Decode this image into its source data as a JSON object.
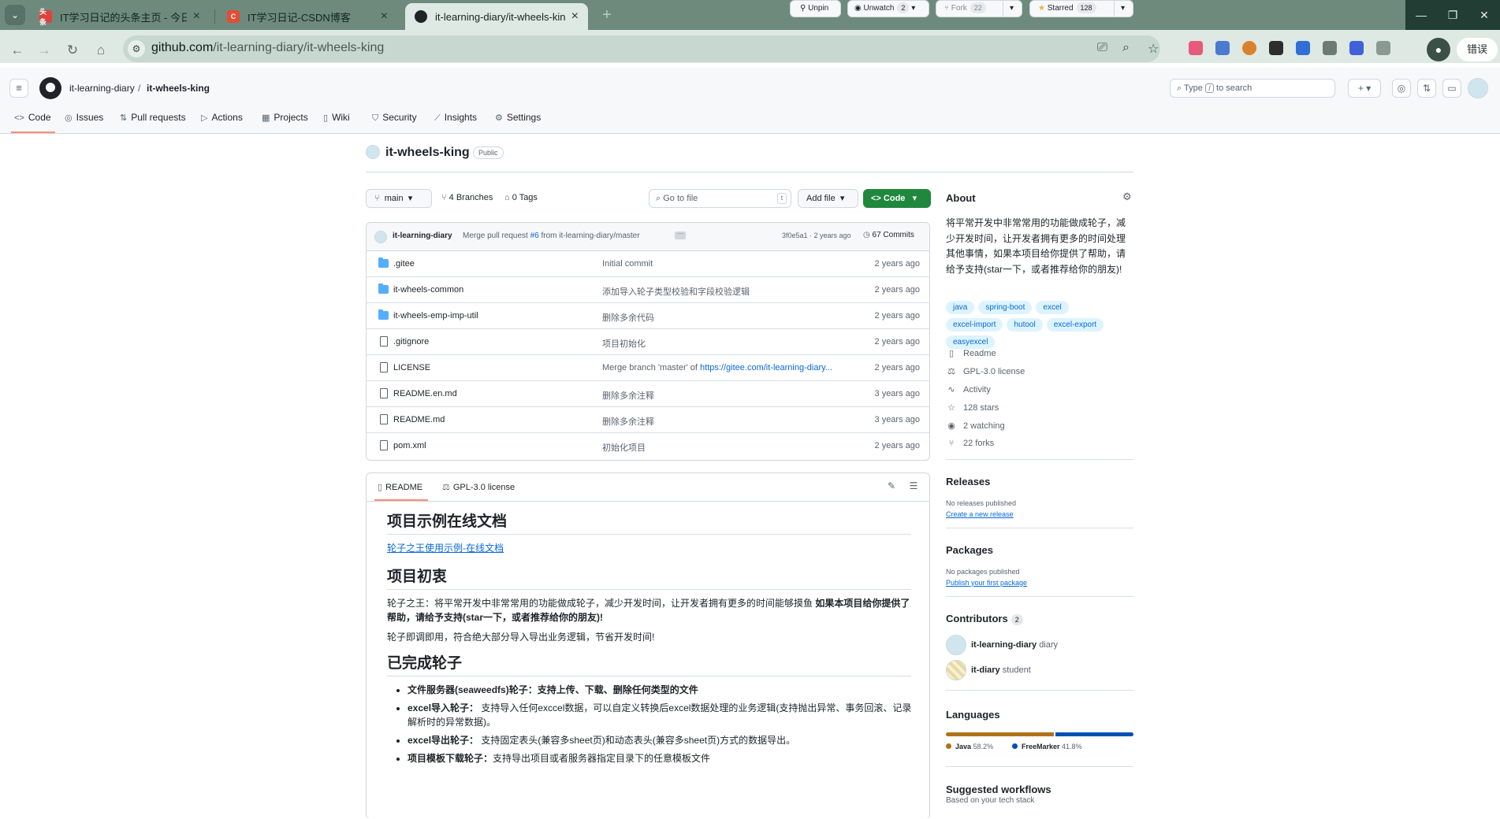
{
  "browser": {
    "tabs": [
      {
        "title": "IT学习日记的头条主页 - 今日头条",
        "favicon": "toutiao",
        "color": "#e0413b",
        "fav_text": "头条"
      },
      {
        "title": "IT学习日记-CSDN博客",
        "favicon": "csdn",
        "color": "#e24d33",
        "fav_text": "C"
      },
      {
        "title": "it-learning-diary/it-wheels-king",
        "favicon": "github",
        "color": "#1f2328",
        "fav_text": ""
      }
    ],
    "url_host": "github.com",
    "url_path": "/it-learning-diary/it-wheels-king",
    "profile_label": "错误",
    "window_controls": [
      "—",
      "❐",
      "✕"
    ]
  },
  "header": {
    "owner": "it-learning-diary",
    "separator": "/",
    "repo": "it-wheels-king",
    "search_prefix": "Type",
    "search_key": "/",
    "search_suffix": "to search",
    "plus_label": "+ ▾"
  },
  "repo_nav": [
    {
      "label": "Code",
      "icon": "<>"
    },
    {
      "label": "Issues",
      "icon": "◎"
    },
    {
      "label": "Pull requests",
      "icon": "⇅"
    },
    {
      "label": "Actions",
      "icon": "▷"
    },
    {
      "label": "Projects",
      "icon": "▦"
    },
    {
      "label": "Wiki",
      "icon": "▯"
    },
    {
      "label": "Security",
      "icon": "⛉"
    },
    {
      "label": "Insights",
      "icon": "⟋"
    },
    {
      "label": "Settings",
      "icon": "⚙"
    }
  ],
  "repo": {
    "name": "it-wheels-king",
    "visibility": "Public",
    "unpin": "Unpin",
    "unwatch": "Unwatch",
    "watch_count": "2",
    "fork": "Fork",
    "fork_count": "22",
    "starred": "Starred",
    "star_count": "128"
  },
  "controls": {
    "branch": "main",
    "branches": "4 Branches",
    "tags": "0 Tags",
    "goto_file": "Go to file",
    "goto_key": "t",
    "add_file": "Add file",
    "code": "Code"
  },
  "latest_commit": {
    "author": "it-learning-diary",
    "message_prefix": "Merge pull request",
    "pr": "#6",
    "message_suffix": "from it-learning-diary/master",
    "dots": "···",
    "sha_time": "3f0e5a1 · 2 years ago",
    "commits": "67 Commits"
  },
  "files": [
    {
      "name": ".gitee",
      "type": "folder",
      "message": "Initial commit",
      "link": "",
      "date": "2 years ago"
    },
    {
      "name": "it-wheels-common",
      "type": "folder",
      "message": "添加导入轮子类型校验和字段校验逻辑",
      "link": "",
      "date": "2 years ago"
    },
    {
      "name": "it-wheels-emp-imp-util",
      "type": "folder",
      "message": "删除多余代码",
      "link": "",
      "date": "2 years ago"
    },
    {
      "name": ".gitignore",
      "type": "file",
      "message": "项目初始化",
      "link": "",
      "date": "2 years ago"
    },
    {
      "name": "LICENSE",
      "type": "file",
      "message": "Merge branch 'master' of ",
      "link": "https://gitee.com/it-learning-diary...",
      "date": "2 years ago"
    },
    {
      "name": "README.en.md",
      "type": "file",
      "message": "删除多余注释",
      "link": "",
      "date": "3 years ago"
    },
    {
      "name": "README.md",
      "type": "file",
      "message": "删除多余注释",
      "link": "",
      "date": "3 years ago"
    },
    {
      "name": "pom.xml",
      "type": "file",
      "message": "初始化项目",
      "link": "",
      "date": "2 years ago"
    }
  ],
  "readme": {
    "tab_readme": "README",
    "tab_license": "GPL-3.0 license",
    "h1": "项目示例在线文档",
    "doc_link": "轮子之王使用示例-在线文档",
    "h2": "项目初衷",
    "intro_normal": "轮子之王：将平常开发中非常常用的功能做成轮子，减少开发时间，让开发者拥有更多的时间能够摸鱼",
    "intro_bold": "如果本项目给你提供了帮助，请给予支持(star一下，或者推荐给你的朋友)!",
    "intro2": "轮子即调即用，符合绝大部分导入导出业务逻辑，节省开发时间!",
    "h3": "已完成轮子",
    "done": [
      {
        "bold": "文件服务器(seaweedfs)轮子：支持上传、下载、删除任何类型的文件",
        "text": ""
      },
      {
        "bold": "excel导入轮子：",
        "text": "支持导入任何exccel数据，可以自定义转换后excel数据处理的业务逻辑(支持抛出异常、事务回滚、记录解析时的异常数据)。"
      },
      {
        "bold": "excel导出轮子：",
        "text": "支持固定表头(兼容多sheet页)和动态表头(兼容多sheet页)方式的数据导出。"
      },
      {
        "bold": "项目模板下载轮子：",
        "text": "支持导出项目或者服务器指定目录下的任意模板文件"
      }
    ]
  },
  "sidebar": {
    "about_title": "About",
    "about_text": "将平常开发中非常常用的功能做成轮子，减少开发时间，让开发者拥有更多的时间处理其他事情，如果本项目给你提供了帮助，请给予支持(star一下，或者推荐给你的朋友)!",
    "topics": [
      "java",
      "spring-boot",
      "excel",
      "excel-import",
      "hutool",
      "excel-export",
      "easyexcel"
    ],
    "stats": [
      {
        "icon": "book-icon",
        "glyph": "▯",
        "label": "Readme"
      },
      {
        "icon": "scale-icon",
        "glyph": "⚖",
        "label": "GPL-3.0 license"
      },
      {
        "icon": "pulse-icon",
        "glyph": "∿",
        "label": "Activity"
      },
      {
        "icon": "star-icon",
        "glyph": "☆",
        "label": "128 stars"
      },
      {
        "icon": "eye-icon",
        "glyph": "◉",
        "label": "2 watching"
      },
      {
        "icon": "fork-icon",
        "glyph": "⑂",
        "label": "22 forks"
      }
    ],
    "releases_title": "Releases",
    "releases_none": "No releases published",
    "releases_link": "Create a new release",
    "packages_title": "Packages",
    "packages_none": "No packages published",
    "packages_link": "Publish your first package",
    "contributors_title": "Contributors",
    "contributors_count": "2",
    "contributors": [
      {
        "login": "it-learning-diary",
        "name": "diary"
      },
      {
        "login": "it-diary",
        "name": "student"
      }
    ],
    "languages_title": "Languages",
    "languages": [
      {
        "name": "Java",
        "percent": "58.2%",
        "value": 58.2,
        "color": "#b07219"
      },
      {
        "name": "FreeMarker",
        "percent": "41.8%",
        "value": 41.8,
        "color": "#0050b2"
      }
    ],
    "workflows_title": "Suggested workflows",
    "workflows_sub": "Based on your tech stack"
  }
}
